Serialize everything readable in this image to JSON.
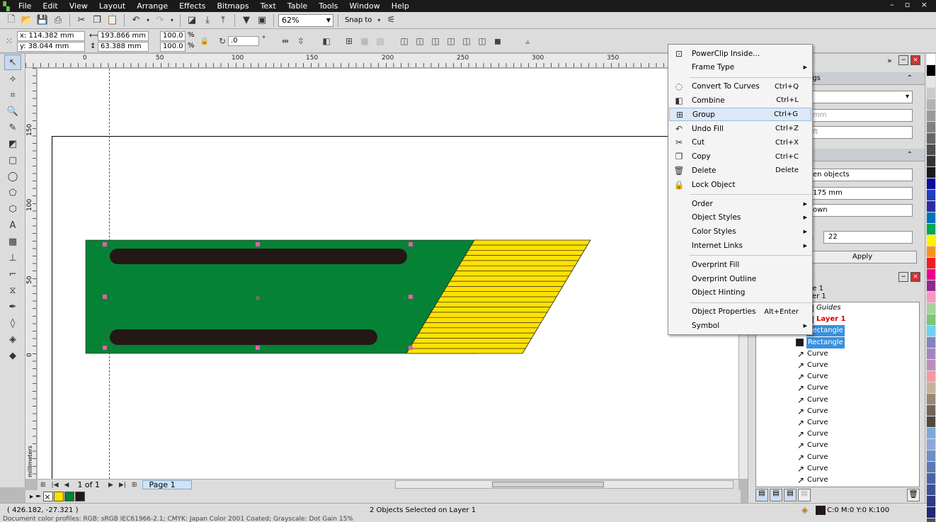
{
  "menu": [
    "File",
    "Edit",
    "View",
    "Layout",
    "Arrange",
    "Effects",
    "Bitmaps",
    "Text",
    "Table",
    "Tools",
    "Window",
    "Help"
  ],
  "window_controls": "– ▫ ×",
  "toolbar": {
    "zoom": "62%",
    "snap_to": "Snap to"
  },
  "property_bar": {
    "x": "x: 114.382 mm",
    "y": "y: 38.044 mm",
    "width": "193.866 mm",
    "height": "63.388 mm",
    "scale_x": "100.0",
    "scale_y": "100.0",
    "percent": "%",
    "rotation": ".0",
    "degree": "°"
  },
  "ruler": {
    "h_labels": [
      "0",
      "50",
      "100",
      "150",
      "200",
      "250",
      "300",
      "350"
    ],
    "v_labels": [
      "150",
      "100",
      "50",
      "0"
    ],
    "unit": "millimeters"
  },
  "page_nav": {
    "count": "1 of 1",
    "tab": "Page 1"
  },
  "status": {
    "coords": "( 426.182, -27.321 )",
    "selection": "2 Objects Selected on Layer 1",
    "fill": "C:0 M:0 Y:0 K:100",
    "doc_info": "Document color profiles: RGB: sRGB IEC61966-2.1; CMYK: Japan Color 2001 Coated; Grayscale: Dot Gain 15%"
  },
  "context_menu": [
    {
      "label": "PowerClip Inside...",
      "shortcut": "",
      "icon": "powerclip-icon",
      "glyph": "⊡",
      "submenu": false,
      "highlighted": false
    },
    {
      "label": "Frame Type",
      "shortcut": "",
      "icon": "",
      "glyph": "",
      "submenu": true,
      "highlighted": false
    },
    {
      "sep": true
    },
    {
      "label": "Convert To Curves",
      "shortcut": "Ctrl+Q",
      "icon": "convert-curves-icon",
      "glyph": "◌",
      "submenu": false,
      "highlighted": false
    },
    {
      "label": "Combine",
      "shortcut": "Ctrl+L",
      "icon": "combine-icon",
      "glyph": "◧",
      "submenu": false,
      "highlighted": false
    },
    {
      "label": "Group",
      "shortcut": "Ctrl+G",
      "icon": "group-icon",
      "glyph": "⊞",
      "submenu": false,
      "highlighted": true
    },
    {
      "label": "Undo Fill",
      "shortcut": "Ctrl+Z",
      "icon": "undo-icon",
      "glyph": "↶",
      "submenu": false,
      "highlighted": false
    },
    {
      "label": "Cut",
      "shortcut": "Ctrl+X",
      "icon": "cut-icon",
      "glyph": "✂",
      "submenu": false,
      "highlighted": false
    },
    {
      "label": "Copy",
      "shortcut": "Ctrl+C",
      "icon": "copy-icon",
      "glyph": "❐",
      "submenu": false,
      "highlighted": false
    },
    {
      "label": "Delete",
      "shortcut": "Delete",
      "icon": "delete-icon",
      "glyph": "🗑",
      "submenu": false,
      "highlighted": false
    },
    {
      "label": "Lock Object",
      "shortcut": "",
      "icon": "lock-icon",
      "glyph": "🔒",
      "submenu": false,
      "highlighted": false
    },
    {
      "sep": true
    },
    {
      "label": "Order",
      "shortcut": "",
      "icon": "",
      "glyph": "",
      "submenu": true,
      "highlighted": false
    },
    {
      "label": "Object Styles",
      "shortcut": "",
      "icon": "",
      "glyph": "",
      "submenu": true,
      "highlighted": false
    },
    {
      "label": "Color Styles",
      "shortcut": "",
      "icon": "",
      "glyph": "",
      "submenu": true,
      "highlighted": false
    },
    {
      "label": "Internet Links",
      "shortcut": "",
      "icon": "",
      "glyph": "",
      "submenu": true,
      "highlighted": false
    },
    {
      "sep": true
    },
    {
      "label": "Overprint Fill",
      "shortcut": "",
      "icon": "",
      "glyph": "",
      "submenu": false,
      "highlighted": false
    },
    {
      "label": "Overprint Outline",
      "shortcut": "",
      "icon": "",
      "glyph": "",
      "submenu": false,
      "highlighted": false
    },
    {
      "label": "Object Hinting",
      "shortcut": "",
      "icon": "",
      "glyph": "",
      "submenu": false,
      "highlighted": false
    },
    {
      "sep": true
    },
    {
      "label": "Object Properties",
      "shortcut": "Alt+Enter",
      "icon": "",
      "glyph": "",
      "submenu": false,
      "highlighted": false
    },
    {
      "label": "Symbol",
      "shortcut": "",
      "icon": "",
      "glyph": "",
      "submenu": true,
      "highlighted": false
    }
  ],
  "docker": {
    "section1_title": "ngs",
    "field_mm": "mm",
    "field_ft": "ft",
    "field_objects": "en objects",
    "field_175": "175 mm",
    "field_down": "own",
    "label_s": "s:",
    "field_22": "22",
    "apply": "Apply",
    "page_name": "ge 1",
    "layer_name": "yer 1",
    "tree": [
      {
        "label": "Guides",
        "type": "layer",
        "color": "#1f1fe0",
        "selected": false,
        "style": "guides"
      },
      {
        "label": "Layer 1",
        "type": "layer",
        "color": "#231815",
        "selected": false,
        "style": "layer"
      },
      {
        "label": "Rectangle",
        "type": "rect",
        "color": "#231815",
        "selected": true,
        "style": "item"
      },
      {
        "label": "Rectangle",
        "type": "rect",
        "color": "#231815",
        "selected": true,
        "style": "item"
      },
      {
        "label": "Curve",
        "type": "curve",
        "selected": false,
        "style": "item"
      },
      {
        "label": "Curve",
        "type": "curve",
        "selected": false,
        "style": "item"
      },
      {
        "label": "Curve",
        "type": "curve",
        "selected": false,
        "style": "item"
      },
      {
        "label": "Curve",
        "type": "curve",
        "selected": false,
        "style": "item"
      },
      {
        "label": "Curve",
        "type": "curve",
        "selected": false,
        "style": "item"
      },
      {
        "label": "Curve",
        "type": "curve",
        "selected": false,
        "style": "item"
      },
      {
        "label": "Curve",
        "type": "curve",
        "selected": false,
        "style": "item"
      },
      {
        "label": "Curve",
        "type": "curve",
        "selected": false,
        "style": "item"
      },
      {
        "label": "Curve",
        "type": "curve",
        "selected": false,
        "style": "item"
      },
      {
        "label": "Curve",
        "type": "curve",
        "selected": false,
        "style": "item"
      },
      {
        "label": "Curve",
        "type": "curve",
        "selected": false,
        "style": "item"
      },
      {
        "label": "Curve",
        "type": "curve",
        "selected": false,
        "style": "item"
      }
    ]
  },
  "colors": {
    "board_green": "#068236",
    "stripe_yellow": "#ffe100",
    "slot_dark": "#231815",
    "handle_pink": "#e95daa",
    "guide_blue": "#3a56b8"
  },
  "document_colors": [
    "#ffe100",
    "#068236",
    "#231815"
  ],
  "palette": [
    "#ffffff",
    "#000000",
    "#e6e6e6",
    "#cccccc",
    "#b3b3b3",
    "#999999",
    "#808080",
    "#666666",
    "#4d4d4d",
    "#333333",
    "#1a1a1a",
    "#0d0d9a",
    "#1e3fbf",
    "#2d2da0",
    "#0072bc",
    "#00a651",
    "#fff200",
    "#f7941d",
    "#ed1c24",
    "#ec008c",
    "#92278f",
    "#f49ac1",
    "#a3d39c",
    "#7cc576",
    "#6dcff6",
    "#8781bd",
    "#a186be",
    "#bd8cbf",
    "#f6989d",
    "#c7b299",
    "#998675",
    "#736357",
    "#534741",
    "#7da7d9",
    "#8ba8d9",
    "#6c8fc6",
    "#5a7ab6",
    "#4b64a5",
    "#3c5096",
    "#2d3c86",
    "#1e2877",
    "#505050"
  ]
}
